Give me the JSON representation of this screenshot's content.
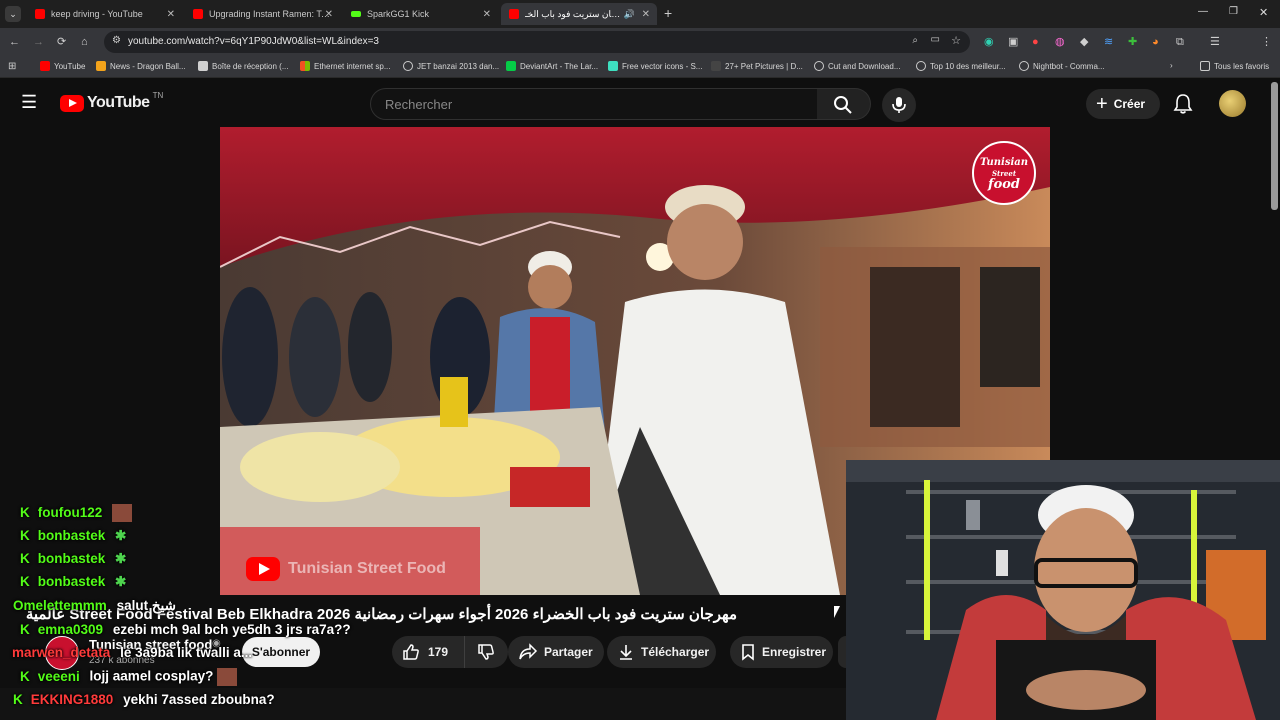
{
  "browser": {
    "tabs": [
      {
        "title": "keep driving - YouTube",
        "active": false
      },
      {
        "title": "Upgrading Instant Ramen: Tom",
        "active": false
      },
      {
        "title": "SparkGG1 Kick",
        "active": false
      },
      {
        "title": "مهرجان ستريت فود باب الخـ",
        "active": true
      }
    ],
    "url": "youtube.com/watch?v=6qY1P90JdW0&list=WL&index=3",
    "bookmarks": [
      "YouTube",
      "News - Dragon Ball...",
      "Boîte de réception (...",
      "Ethernet internet sp...",
      "JET banzai 2013 dan...",
      "DeviantArt - The Lar...",
      "Free vector icons - S...",
      "27+ Pet Pictures | D...",
      "Cut and Download...",
      "Top 10 des meilleur...",
      "Nightbot - Comma..."
    ],
    "all_bookmarks": "Tous les favoris"
  },
  "youtube": {
    "logo_text": "YouTube",
    "logo_country": "TN",
    "search_placeholder": "Rechercher",
    "create_label": "Créer",
    "video": {
      "watermark": "Tunisian Street Food",
      "channel_badge": [
        "Tunisian",
        "Street",
        "food"
      ],
      "title": "مهرجان ستريت فود باب الخضراء 2026 أجواء سهرات رمضانية 2026 Street Food Festival Beb Elkhadra عالمية"
    },
    "channel": {
      "name": "Tunisian street food",
      "subscribers": "237 k abonnés",
      "subscribe_label": "S'abonner"
    },
    "actions": {
      "likes": "179",
      "share": "Partager",
      "download": "Télécharger",
      "save": "Enregistrer"
    }
  },
  "chat": [
    {
      "user": "foufou122",
      "message": "",
      "user_color": "#53fc18"
    },
    {
      "user": "bonbastek",
      "message": "",
      "user_color": "#53fc18"
    },
    {
      "user": "bonbastek",
      "message": "",
      "user_color": "#53fc18"
    },
    {
      "user": "bonbastek",
      "message": "",
      "user_color": "#53fc18"
    },
    {
      "user": "Omelettemmm",
      "message": "salut شيخ",
      "user_color": "#53fc18"
    },
    {
      "user": "emna0309",
      "message": "ezebi mch 9al bch ye5dh 3 jrs ra7a??",
      "user_color": "#53fc18"
    },
    {
      "user": "marwen_detata",
      "message": "le 3a9ba lik twalli a...",
      "user_color": "#ff3b3b"
    },
    {
      "user": "veeeni",
      "message": "lojj aamel cosplay?",
      "user_color": "#53fc18"
    },
    {
      "user": "EKKING1880",
      "message": "yekhi 7assed zboubna?",
      "user_color": "#ff3b3b"
    }
  ],
  "colors": {
    "accent_red": "#ff0000",
    "kick_green": "#53fc18"
  }
}
